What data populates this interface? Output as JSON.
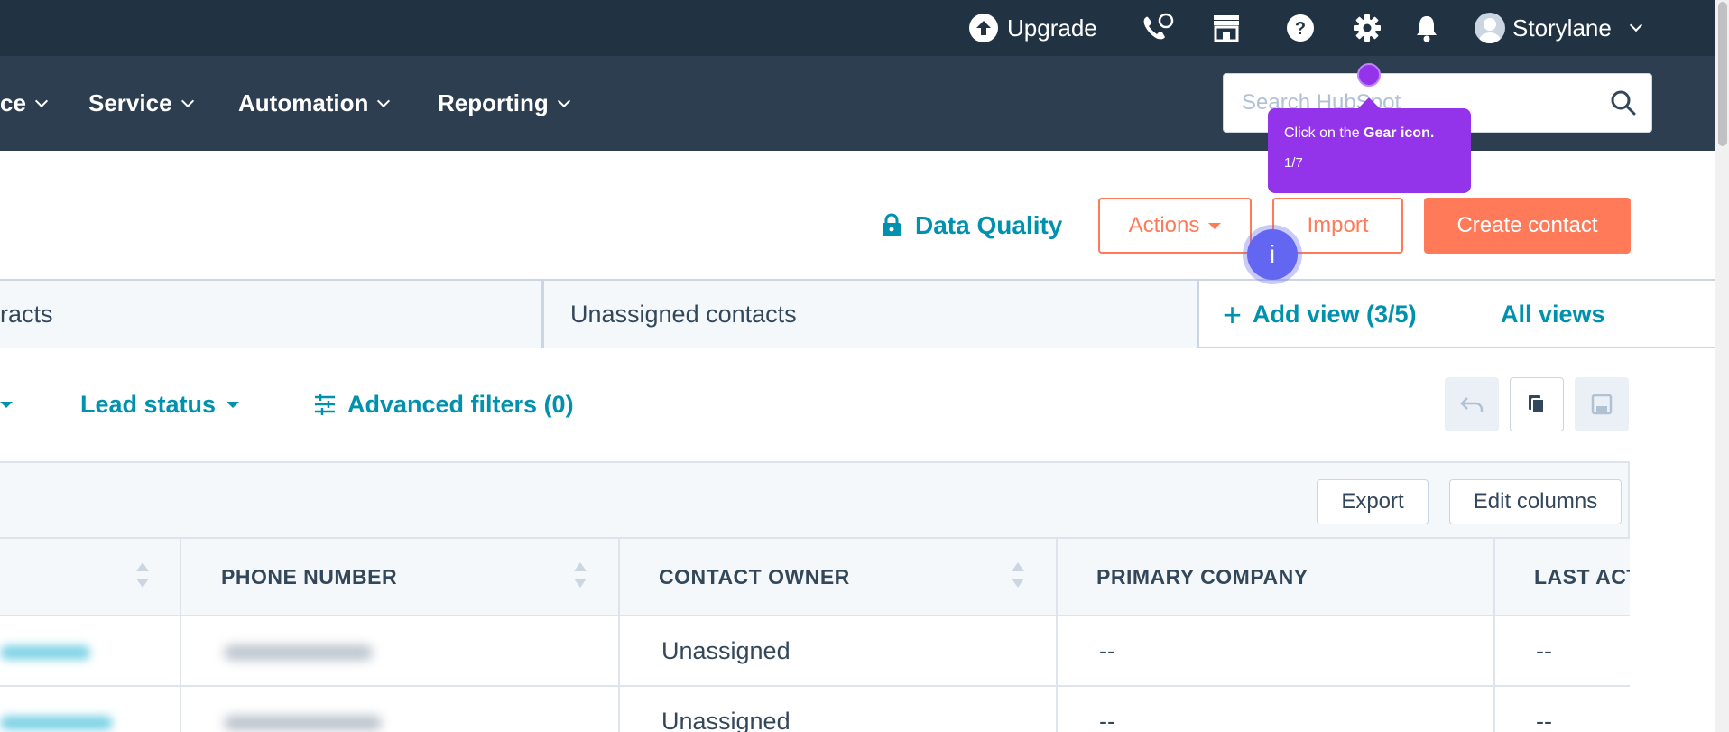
{
  "topbar": {
    "upgrade_label": "Upgrade",
    "user_name": "Storylane",
    "icons": [
      "calling-icon",
      "marketplace-icon",
      "help-icon",
      "gear-icon",
      "notifications-icon"
    ]
  },
  "nav": {
    "items": [
      {
        "label": "ce"
      },
      {
        "label": "Service"
      },
      {
        "label": "Automation"
      },
      {
        "label": "Reporting"
      }
    ],
    "search_placeholder": "Search HubSpot"
  },
  "header": {
    "data_quality_label": "Data Quality",
    "actions_label": "Actions",
    "import_label": "Import",
    "create_label": "Create contact"
  },
  "views": {
    "tabs": [
      {
        "label": "racts"
      },
      {
        "label": "Unassigned contacts"
      }
    ],
    "add_view_label": "Add view (3/5)",
    "all_views_label": "All views"
  },
  "filters": {
    "lead_status_label": "Lead status",
    "advanced_label": "Advanced filters (0)"
  },
  "table": {
    "export_label": "Export",
    "edit_columns_label": "Edit columns",
    "columns": [
      "PHONE NUMBER",
      "CONTACT OWNER",
      "PRIMARY COMPANY",
      "LAST ACT"
    ],
    "rows": [
      {
        "owner": "Unassigned",
        "company": "--",
        "last_activity": "--"
      },
      {
        "owner": "Unassigned",
        "company": "--",
        "last_activity": "--"
      }
    ]
  },
  "guide": {
    "tooltip_prefix": "Click on the ",
    "tooltip_bold": "Gear icon.",
    "step": "1/7",
    "info_label": "i"
  },
  "colors": {
    "topbar": "#213343",
    "navbar": "#2d3e50",
    "accent_teal": "#0091ae",
    "accent_orange": "#ff7a59",
    "guide_purple": "#9333ea"
  }
}
